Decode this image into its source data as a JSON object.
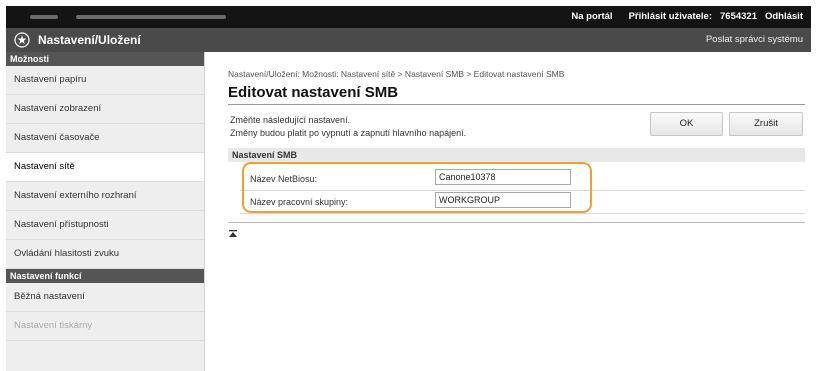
{
  "topbar": {
    "portal_label": "Na portál",
    "login_label": "Přihlásit uživatele:",
    "user_id": "7654321",
    "logout_label": "Odhlásit"
  },
  "titlebar": {
    "title": "Nastavení/Uložení",
    "mail_admin": "Poslat správci systému"
  },
  "sidebar": {
    "section1": "Možnosti",
    "items1": [
      {
        "label": "Nastavení papíru"
      },
      {
        "label": "Nastavení zobrazení"
      },
      {
        "label": "Nastavení časovače"
      },
      {
        "label": "Nastavení sítě"
      },
      {
        "label": "Nastavení externího rozhraní"
      },
      {
        "label": "Nastavení přístupnosti"
      },
      {
        "label": "Ovládání hlasitosti zvuku"
      }
    ],
    "section2": "Nastavení funkcí",
    "items2": [
      {
        "label": "Běžná nastavení"
      },
      {
        "label": "Nastavení tiskárny"
      }
    ]
  },
  "main": {
    "breadcrumb": "Nastavení/Uložení: Možnosti: Nastavení sítě > Nastavení SMB > Editovat nastavení SMB",
    "title": "Editovat nastavení SMB",
    "intro_line1": "Změňte následující nastavení.",
    "intro_line2": "Změny budou platit po vypnutí a zapnutí hlavního napájení.",
    "ok_label": "OK",
    "cancel_label": "Zrušit",
    "section_title": "Nastavení SMB",
    "fields": [
      {
        "label": "Název NetBiosu:",
        "value": "Canone10378"
      },
      {
        "label": "Název pracovní skupiny:",
        "value": "WORKGROUP"
      }
    ]
  },
  "colors": {
    "topbar": "#141414",
    "titlebar": "#4a4a4a",
    "highlight": "#f0a030"
  }
}
